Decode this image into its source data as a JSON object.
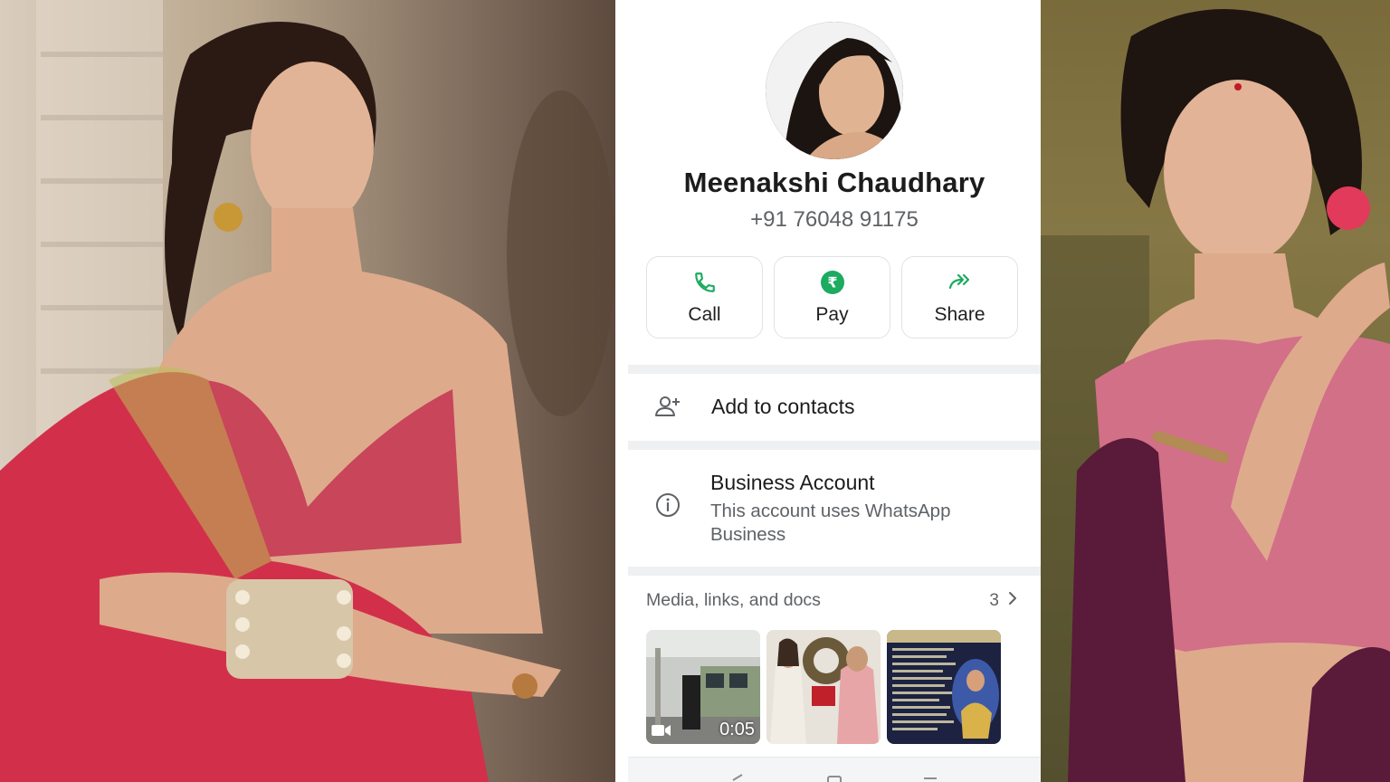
{
  "contact": {
    "name": "Meenakshi Chaudhary",
    "phone": "+91 76048 91175"
  },
  "actions": [
    {
      "label": "Call",
      "icon": "phone-icon"
    },
    {
      "label": "Pay",
      "icon": "rupee-icon"
    },
    {
      "label": "Share",
      "icon": "share-forward-icon"
    }
  ],
  "add_contact": {
    "label": "Add to contacts",
    "icon": "person-add-icon"
  },
  "business": {
    "title": "Business Account",
    "description": "This account uses WhatsApp Business",
    "icon": "info-icon"
  },
  "media": {
    "title": "Media, links, and docs",
    "count": "3",
    "items": [
      {
        "type": "video",
        "duration": "0:05"
      },
      {
        "type": "image"
      },
      {
        "type": "image"
      }
    ]
  },
  "colors": {
    "accent_green": "#1DAA61",
    "text_primary": "#1c1c1c",
    "text_secondary": "#5e6266",
    "divider": "#eef0f1"
  }
}
